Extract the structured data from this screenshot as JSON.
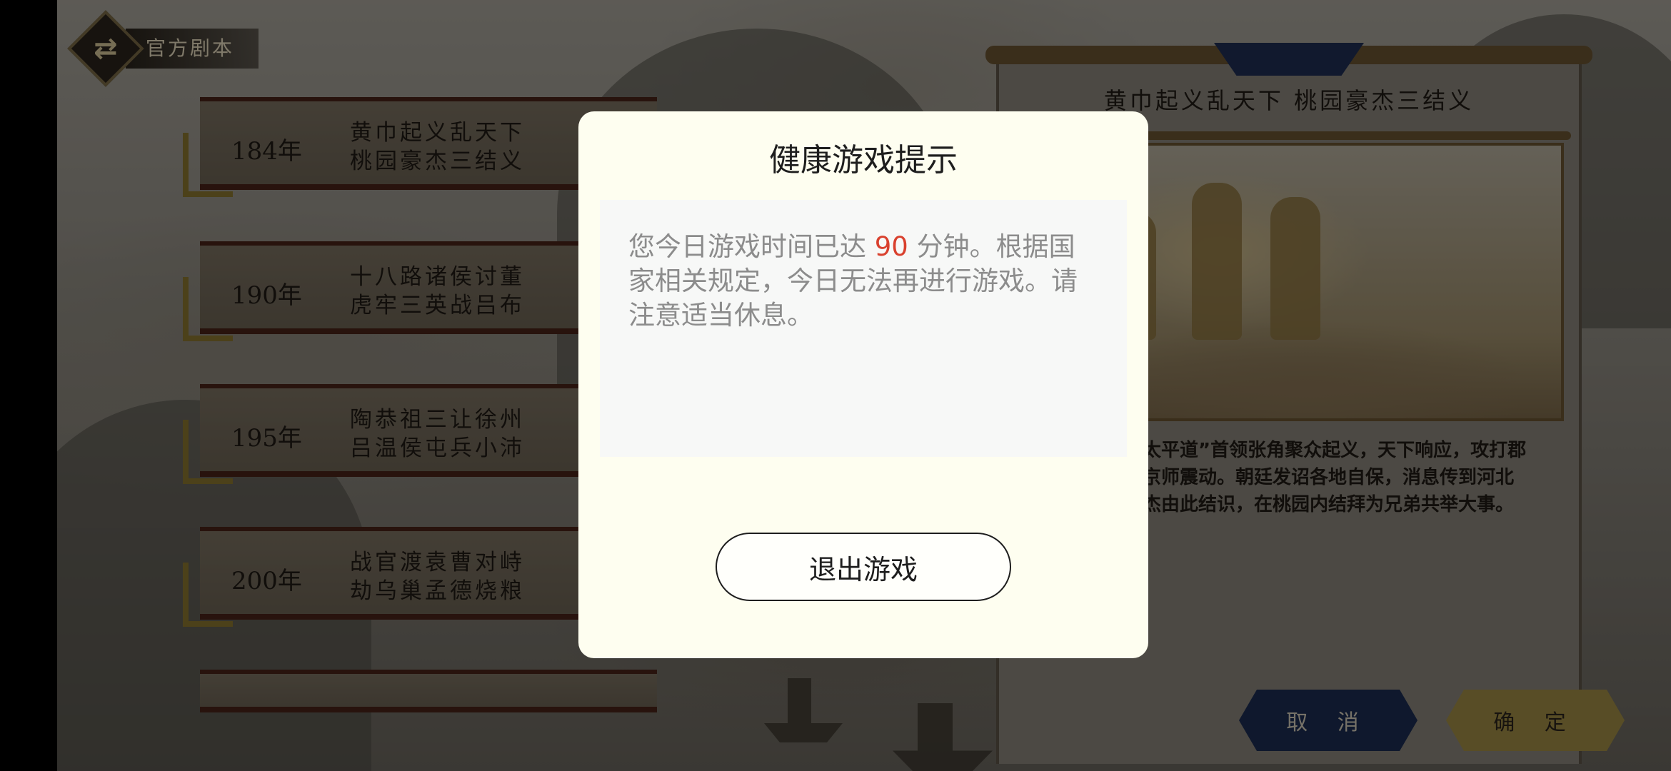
{
  "badge": {
    "icon": "switch-arrows-icon",
    "label": "官方剧本"
  },
  "scenarios": [
    {
      "year": "184年",
      "line1": "黄巾起义乱天下",
      "line2": "桃园豪杰三结义"
    },
    {
      "year": "190年",
      "line1": "十八路诸侯讨董",
      "line2": "虎牢三英战吕布"
    },
    {
      "year": "195年",
      "line1": "陶恭祖三让徐州",
      "line2": "吕温侯屯兵小沛"
    },
    {
      "year": "200年",
      "line1": "战官渡袁曹对峙",
      "line2": "劫乌巢孟德烧粮"
    }
  ],
  "panel": {
    "title": "黄巾起义乱天下  桃园豪杰三结义",
    "desc_line1": "太平道”首领张角聚众起义，天下响应，攻打郡",
    "desc_line2": "京师震动。朝廷发诏各地自保，消息传到河北",
    "desc_line3": "杰由此结识，在桃园内结拜为兄弟共举大事。"
  },
  "buttons": {
    "cancel": "取 消",
    "confirm": "确 定"
  },
  "dialog": {
    "title": "健康游戏提示",
    "text_prefix": "您今日游戏时间已达",
    "minutes": "90",
    "text_suffix": "分钟。根据国家相关规定，今日无法再进行游戏。请注意适当休息。",
    "exit_label": "退出游戏"
  },
  "colors": {
    "dialog_bg": "#fefef0",
    "highlight": "#d9412e",
    "cancel_bg": "#1d2c52",
    "confirm_bg": "#a08d45"
  }
}
